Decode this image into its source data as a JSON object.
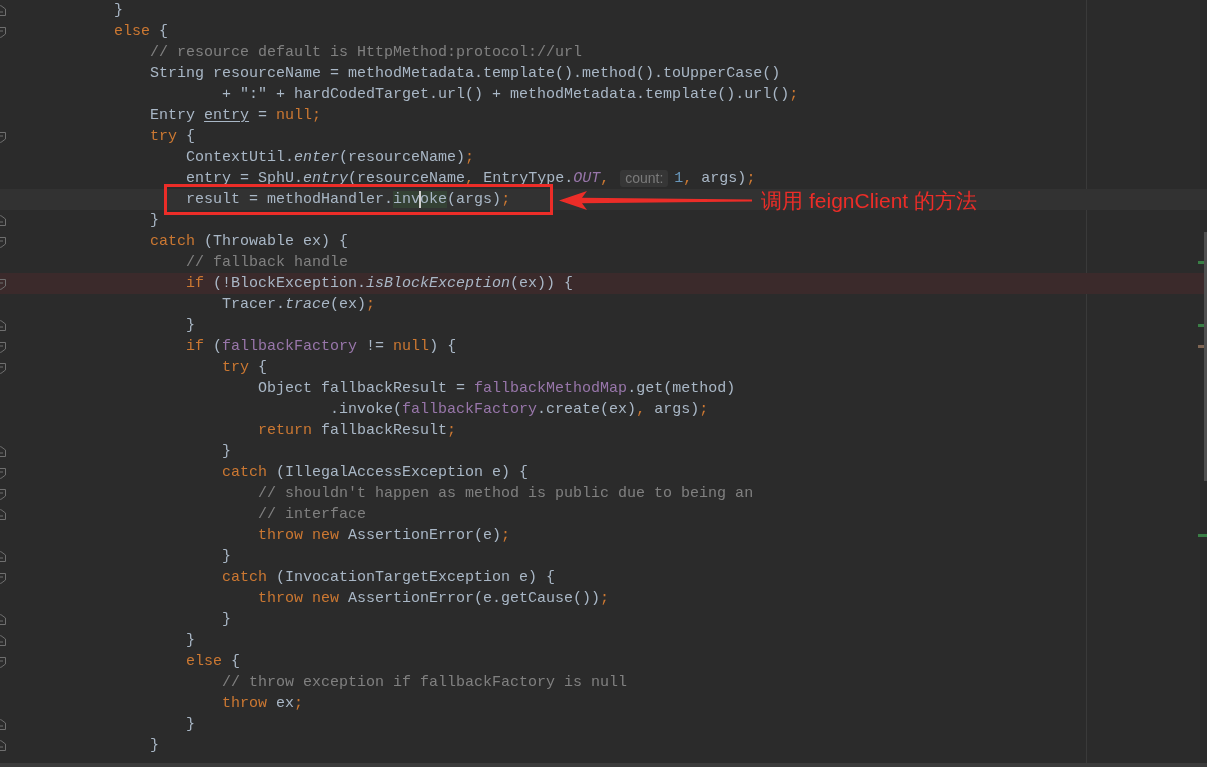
{
  "lines": [
    {
      "fold_marker": {
        "kind": "end"
      },
      "tokens": [
        {
          "text": "            }",
          "kind": "plain"
        }
      ]
    },
    {
      "fold_marker": {
        "kind": "start"
      },
      "tokens": [
        {
          "text": "            else",
          "kind": "keyword"
        },
        {
          "text": " {",
          "kind": "plain"
        }
      ]
    },
    {
      "tokens": [
        {
          "text": "                // resource default is HttpMethod:protocol://url",
          "kind": "comment"
        }
      ]
    },
    {
      "tokens": [
        {
          "text": "                String resourceName = methodMetadata.template().method().toUpperCase()",
          "kind": "plain"
        }
      ]
    },
    {
      "tokens": [
        {
          "text": "                        + \":\" + hardCodedTarget.url() + methodMetadata.template().url()",
          "kind": "plain"
        },
        {
          "text": ";",
          "kind": "punct"
        }
      ]
    },
    {
      "tokens": [
        {
          "text": "                Entry ",
          "kind": "plain"
        },
        {
          "text": "entry",
          "kind": "reassigned"
        },
        {
          "text": " = ",
          "kind": "plain"
        },
        {
          "text": "null",
          "kind": "keyword"
        },
        {
          "text": ";",
          "kind": "punct"
        }
      ]
    },
    {
      "fold_marker": {
        "kind": "start"
      },
      "tokens": [
        {
          "text": "                try",
          "kind": "keyword"
        },
        {
          "text": " {",
          "kind": "plain"
        }
      ]
    },
    {
      "tokens": [
        {
          "text": "                    ContextUtil.",
          "kind": "plain"
        },
        {
          "text": "enter",
          "kind": "static"
        },
        {
          "text": "(resourceName)",
          "kind": "plain"
        },
        {
          "text": ";",
          "kind": "punct"
        }
      ]
    },
    {
      "tokens": [
        {
          "text": "                    entry = SphU.",
          "kind": "plain"
        },
        {
          "text": "entry",
          "kind": "static"
        },
        {
          "text": "(resourceName",
          "kind": "plain"
        },
        {
          "text": ",",
          "kind": "punct"
        },
        {
          "text": " EntryType.",
          "kind": "plain"
        },
        {
          "text": "OUT",
          "kind": "static_field"
        },
        {
          "text": ", ",
          "kind": "punct"
        },
        {
          "text": "count:",
          "kind": "hint"
        },
        {
          "text": "1",
          "kind": "number"
        },
        {
          "text": ",",
          "kind": "punct"
        },
        {
          "text": " args)",
          "kind": "plain"
        },
        {
          "text": ";",
          "kind": "punct"
        }
      ]
    },
    {
      "current": true,
      "annotation": {
        "label": "调用 feignClient 的方法"
      },
      "tokens": [
        {
          "text": "                    result = methodHandler.",
          "kind": "plain"
        },
        {
          "text": "inv",
          "kind": "match",
          "caret_after": true
        },
        {
          "text": "oke",
          "kind": "match"
        },
        {
          "text": "(args)",
          "kind": "plain"
        },
        {
          "text": ";",
          "kind": "punct"
        }
      ]
    },
    {
      "fold_marker": {
        "kind": "end"
      },
      "tokens": [
        {
          "text": "                }",
          "kind": "plain"
        }
      ]
    },
    {
      "fold_marker": {
        "kind": "start"
      },
      "tokens": [
        {
          "text": "                catch",
          "kind": "keyword"
        },
        {
          "text": " (Throwable ex) {",
          "kind": "plain"
        }
      ]
    },
    {
      "marker": {
        "color": "#3a7f46"
      },
      "tokens": [
        {
          "text": "                    // fallback handle",
          "kind": "comment"
        }
      ]
    },
    {
      "breakpoint": true,
      "fold_marker": {
        "kind": "start"
      },
      "tokens": [
        {
          "text": "                    if",
          "kind": "keyword"
        },
        {
          "text": " (!BlockException.",
          "kind": "plain"
        },
        {
          "text": "isBlockException",
          "kind": "static"
        },
        {
          "text": "(ex)) {",
          "kind": "plain"
        }
      ]
    },
    {
      "tokens": [
        {
          "text": "                        Tracer.",
          "kind": "plain"
        },
        {
          "text": "trace",
          "kind": "static"
        },
        {
          "text": "(ex)",
          "kind": "plain"
        },
        {
          "text": ";",
          "kind": "punct"
        }
      ]
    },
    {
      "fold_marker": {
        "kind": "end"
      },
      "marker": {
        "color": "#3a7f46"
      },
      "tokens": [
        {
          "text": "                    }",
          "kind": "plain"
        }
      ]
    },
    {
      "fold_marker": {
        "kind": "start"
      },
      "marker": {
        "color": "#7e6553"
      },
      "tokens": [
        {
          "text": "                    if",
          "kind": "keyword"
        },
        {
          "text": " (",
          "kind": "plain"
        },
        {
          "text": "fallbackFactory",
          "kind": "field"
        },
        {
          "text": " != ",
          "kind": "plain"
        },
        {
          "text": "null",
          "kind": "keyword"
        },
        {
          "text": ") {",
          "kind": "plain"
        }
      ]
    },
    {
      "fold_marker": {
        "kind": "start"
      },
      "tokens": [
        {
          "text": "                        try",
          "kind": "keyword"
        },
        {
          "text": " {",
          "kind": "plain"
        }
      ]
    },
    {
      "tokens": [
        {
          "text": "                            Object fallbackResult = ",
          "kind": "plain"
        },
        {
          "text": "fallbackMethodMap",
          "kind": "field"
        },
        {
          "text": ".get(method)",
          "kind": "plain"
        }
      ]
    },
    {
      "tokens": [
        {
          "text": "                                    .invoke(",
          "kind": "plain"
        },
        {
          "text": "fallbackFactory",
          "kind": "field"
        },
        {
          "text": ".create(ex)",
          "kind": "plain"
        },
        {
          "text": ",",
          "kind": "punct"
        },
        {
          "text": " args)",
          "kind": "plain"
        },
        {
          "text": ";",
          "kind": "punct"
        }
      ]
    },
    {
      "tokens": [
        {
          "text": "                            return",
          "kind": "keyword"
        },
        {
          "text": " fallbackResult",
          "kind": "plain"
        },
        {
          "text": ";",
          "kind": "punct"
        }
      ]
    },
    {
      "fold_marker": {
        "kind": "end"
      },
      "tokens": [
        {
          "text": "                        }",
          "kind": "plain"
        }
      ]
    },
    {
      "fold_marker": {
        "kind": "start"
      },
      "tokens": [
        {
          "text": "                        catch",
          "kind": "keyword"
        },
        {
          "text": " (IllegalAccessException e) {",
          "kind": "plain"
        }
      ]
    },
    {
      "fold_marker": {
        "kind": "start"
      },
      "tokens": [
        {
          "text": "                            // shouldn't happen as method is public due to being an",
          "kind": "comment"
        }
      ]
    },
    {
      "fold_marker": {
        "kind": "end"
      },
      "tokens": [
        {
          "text": "                            // interface",
          "kind": "comment"
        }
      ]
    },
    {
      "marker": {
        "color": "#3a7f46"
      },
      "tokens": [
        {
          "text": "                            throw new",
          "kind": "keyword"
        },
        {
          "text": " AssertionError(e)",
          "kind": "plain"
        },
        {
          "text": ";",
          "kind": "punct"
        }
      ]
    },
    {
      "fold_marker": {
        "kind": "end"
      },
      "tokens": [
        {
          "text": "                        }",
          "kind": "plain"
        }
      ]
    },
    {
      "fold_marker": {
        "kind": "start"
      },
      "tokens": [
        {
          "text": "                        catch",
          "kind": "keyword"
        },
        {
          "text": " (InvocationTargetException e) {",
          "kind": "plain"
        }
      ]
    },
    {
      "tokens": [
        {
          "text": "                            throw new",
          "kind": "keyword"
        },
        {
          "text": " AssertionError(e.getCause())",
          "kind": "plain"
        },
        {
          "text": ";",
          "kind": "punct"
        }
      ]
    },
    {
      "fold_marker": {
        "kind": "end"
      },
      "tokens": [
        {
          "text": "                        }",
          "kind": "plain"
        }
      ]
    },
    {
      "fold_marker": {
        "kind": "end"
      },
      "tokens": [
        {
          "text": "                    }",
          "kind": "plain"
        }
      ]
    },
    {
      "fold_marker": {
        "kind": "start"
      },
      "tokens": [
        {
          "text": "                    else",
          "kind": "keyword"
        },
        {
          "text": " {",
          "kind": "plain"
        }
      ]
    },
    {
      "tokens": [
        {
          "text": "                        // throw exception if fallbackFactory is null",
          "kind": "comment"
        }
      ]
    },
    {
      "tokens": [
        {
          "text": "                        throw",
          "kind": "keyword"
        },
        {
          "text": " ex",
          "kind": "plain"
        },
        {
          "text": ";",
          "kind": "punct"
        }
      ]
    },
    {
      "fold_marker": {
        "kind": "end"
      },
      "tokens": [
        {
          "text": "                    }",
          "kind": "plain"
        }
      ]
    },
    {
      "fold_marker": {
        "kind": "end"
      },
      "tokens": [
        {
          "text": "                }",
          "kind": "plain"
        }
      ]
    }
  ]
}
